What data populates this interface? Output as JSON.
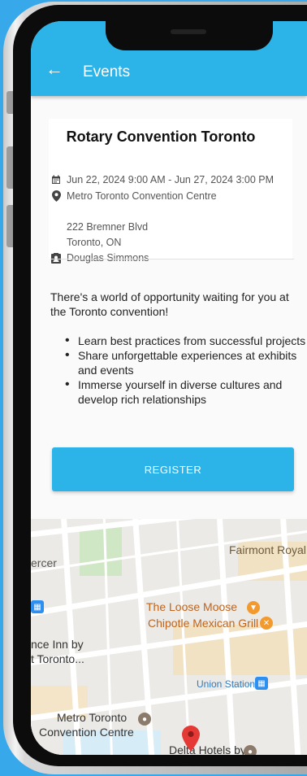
{
  "header": {
    "back_icon": "arrow-left-icon",
    "title": "Events"
  },
  "event": {
    "title": "Rotary Convention Toronto",
    "date_range": "Jun 22, 2024  9:00 AM -  Jun 27, 2024  3:00 PM",
    "venue": "Metro Toronto Convention Centre",
    "address_line": "222 Bremner Blvd",
    "city": "Toronto, ON",
    "contact": "Douglas Simmons",
    "description": "There's a world of opportunity waiting for you at the Toronto convention!",
    "bullets": [
      "Learn best practices from successful projects",
      "Share unforgettable experiences at exhibits and events",
      "Immerse yourself in diverse cultures and develop rich relationships"
    ],
    "register_label": "REGISTER"
  },
  "map": {
    "labels": {
      "fairmont": "Fairmont Royal",
      "mercer": "ercer",
      "loose_moose": "The Loose Moose",
      "chipotle": "Chipotle Mexican Grill",
      "inn": "nce Inn by",
      "inn2": "t Toronto...",
      "union": "Union Station",
      "mtcc": "Metro Toronto",
      "mtcc2": "Convention Centre",
      "delta": "Delta Hotels by"
    }
  },
  "colors": {
    "accent": "#2cb3e8",
    "background": "#37a9ea",
    "poi_orange": "#f29a2e",
    "transit_blue": "#2d8ff0",
    "pin_red": "#e53935"
  }
}
